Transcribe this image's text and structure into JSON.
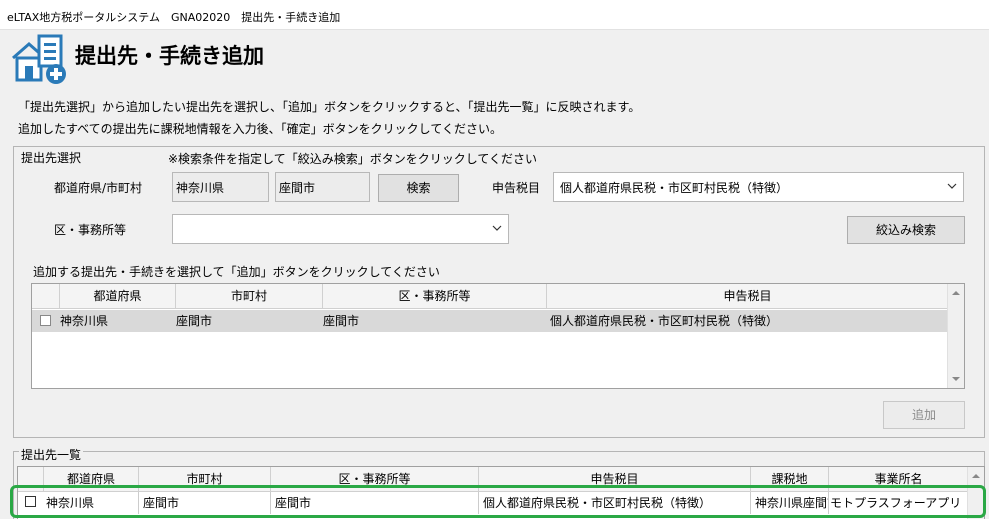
{
  "window": {
    "title": "eLTAX地方税ポータルシステム　GNA02020　提出先・手続き追加"
  },
  "header": {
    "title": "提出先・手続き追加"
  },
  "intro": {
    "line1": "「提出先選択」から追加したい提出先を選択し、「追加」ボタンをクリックすると、「提出先一覧」に反映されます。",
    "line2": "追加したすべての提出先に課税地情報を入力後、「確定」ボタンをクリックしてください。"
  },
  "selection": {
    "legend": "提出先選択",
    "note": "※検索条件を指定して「絞込み検索」ボタンをクリックしてください",
    "prefecture_label": "都道府県/市町村",
    "prefecture_value": "神奈川県",
    "city_value": "座間市",
    "search_button": "検索",
    "tax_label": "申告税目",
    "tax_value": "個人都道府県民税・市区町村民税（特徴）",
    "office_label": "区・事務所等",
    "office_value": "",
    "filter_button": "絞込み検索",
    "table_caption": "追加する提出先・手続きを選択して「追加」ボタンをクリックしてください",
    "columns": [
      "都道府県",
      "市町村",
      "区・事務所等",
      "申告税目"
    ],
    "rows": [
      {
        "checked": false,
        "prefecture": "神奈川県",
        "city": "座間市",
        "office": "座間市",
        "tax": "個人都道府県民税・市区町村民税（特徴）"
      }
    ],
    "add_button": "追加"
  },
  "list": {
    "legend": "提出先一覧",
    "columns": [
      "都道府県",
      "市町村",
      "区・事務所等",
      "申告税目",
      "課税地",
      "事業所名"
    ],
    "rows": [
      {
        "checked": false,
        "prefecture": "神奈川県",
        "city": "座間市",
        "office": "座間市",
        "tax": "個人都道府県民税・市区町村民税（特徴）",
        "location": "神奈川県座間市",
        "business": "モトプラスフォーアプリ"
      }
    ]
  },
  "colors": {
    "highlight": "#2aa845",
    "selected_row": "#d9d9d9"
  }
}
